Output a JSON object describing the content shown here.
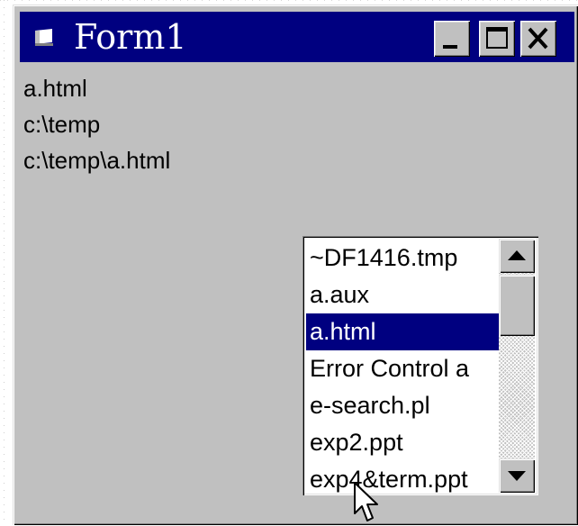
{
  "window": {
    "title": "Form1",
    "controls": [
      "minimize",
      "maximize",
      "close"
    ]
  },
  "labels": [
    "a.html",
    "c:\\temp",
    "c:\\temp\\a.html"
  ],
  "file_list": {
    "items": [
      "~DF1416.tmp",
      "a.aux",
      "a.html",
      "Error Control a",
      "e-search.pl",
      "exp2.ppt",
      "exp4&term.ppt"
    ],
    "selected": "a.html"
  },
  "colors": {
    "titlebar": "#000080",
    "face": "#c0c0c0",
    "selection": "#000080"
  }
}
